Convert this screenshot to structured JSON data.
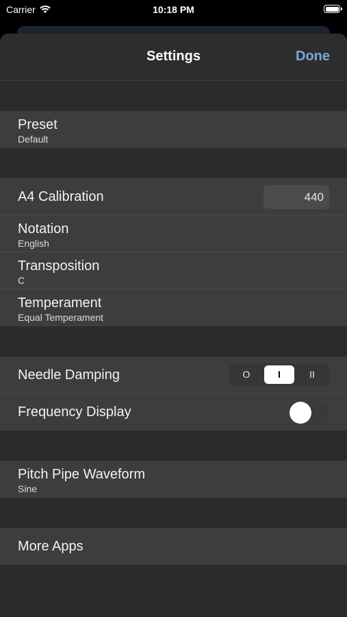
{
  "status": {
    "carrier": "Carrier",
    "time": "10:18 PM"
  },
  "nav": {
    "title": "Settings",
    "done": "Done"
  },
  "preset": {
    "title": "Preset",
    "value": "Default"
  },
  "calibration": {
    "title": "A4 Calibration",
    "value": "440"
  },
  "notation": {
    "title": "Notation",
    "value": "English"
  },
  "transposition": {
    "title": "Transposition",
    "value": "C"
  },
  "temperament": {
    "title": "Temperament",
    "value": "Equal Temperament"
  },
  "damping": {
    "title": "Needle Damping",
    "options": [
      "O",
      "I",
      "II"
    ],
    "selected": "I"
  },
  "frequency": {
    "title": "Frequency Display",
    "enabled": false
  },
  "waveform": {
    "title": "Pitch Pipe Waveform",
    "value": "Sine"
  },
  "more": {
    "title": "More Apps"
  },
  "colors": {
    "accent": "#7aa7d3",
    "row": "#3d3d3d",
    "sheet": "#2b2b2b"
  }
}
